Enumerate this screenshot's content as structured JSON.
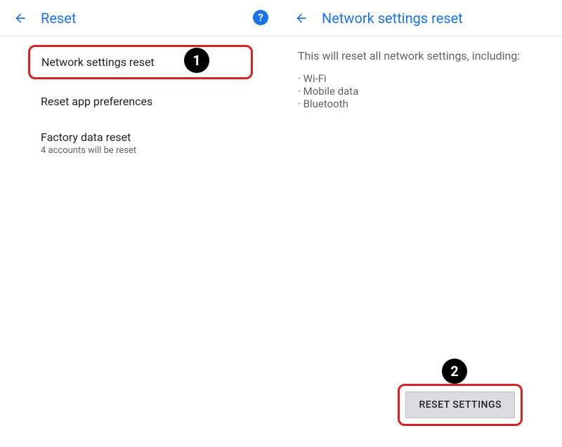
{
  "left": {
    "title": "Reset",
    "items": [
      {
        "title": "Network settings reset",
        "sub": ""
      },
      {
        "title": "Reset app preferences",
        "sub": ""
      },
      {
        "title": "Factory data reset",
        "sub": "4 accounts will be reset"
      }
    ]
  },
  "right": {
    "title": "Network settings reset",
    "intro": "This will reset all network settings, including:",
    "bullets": [
      "Wi-Fi",
      "Mobile data",
      "Bluetooth"
    ],
    "button": "RESET SETTINGS"
  },
  "annotations": {
    "badge1": "1",
    "badge2": "2"
  },
  "colors": {
    "accent": "#1a73e8",
    "highlight": "#d62222"
  }
}
